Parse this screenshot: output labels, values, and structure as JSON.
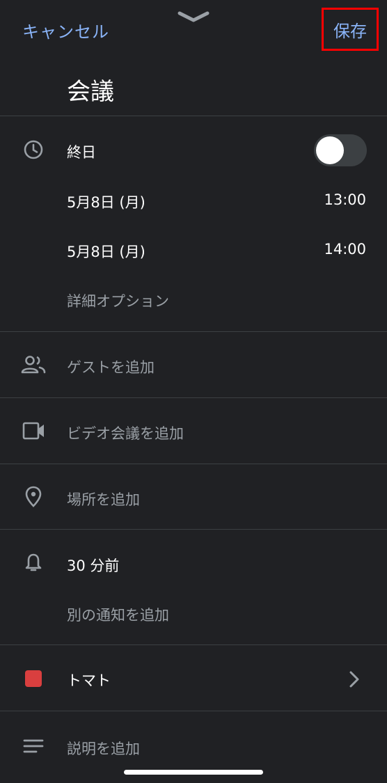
{
  "header": {
    "cancel_label": "キャンセル",
    "save_label": "保存"
  },
  "event": {
    "title": "会議",
    "all_day_label": "終日",
    "all_day_on": false,
    "start_date": "5月8日 (月)",
    "start_time": "13:00",
    "end_date": "5月8日 (月)",
    "end_time": "14:00",
    "more_options_label": "詳細オプション"
  },
  "rows": {
    "guests_label": "ゲストを追加",
    "video_label": "ビデオ会議を追加",
    "location_label": "場所を追加",
    "notification_label": "30 分前",
    "add_notification_label": "別の通知を追加",
    "calendar_color_label": "トマト",
    "description_label": "説明を追加"
  },
  "colors": {
    "background": "#202124",
    "accent": "#8ab4f8",
    "highlight_box": "#ff0000",
    "tomato": "#d93f3f"
  },
  "icons": {
    "handle": "chevron-down-icon",
    "time": "clock-icon",
    "guests": "people-icon",
    "video": "video-camera-icon",
    "location": "location-pin-icon",
    "notification": "bell-icon",
    "calendar_color": "color-square-icon",
    "calendar_chevron": "chevron-right-icon",
    "description": "notes-lines-icon"
  }
}
